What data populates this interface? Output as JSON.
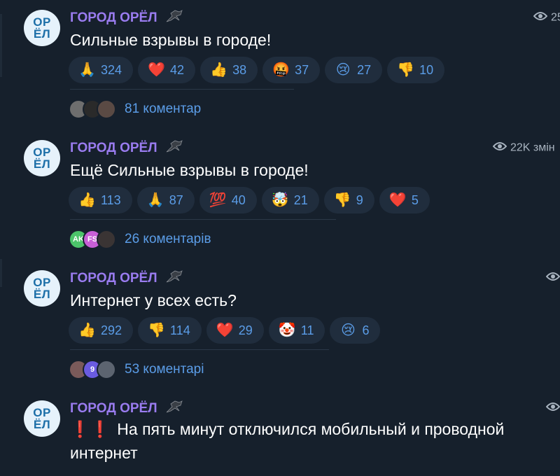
{
  "colors": {
    "background": "#16202c",
    "author": "#9a7cf0",
    "link": "#5b9de8",
    "reaction_bg": "#202d3d",
    "avatar_bg": "#e6f2fb",
    "avatar_fg": "#1d6fa8"
  },
  "posts": [
    {
      "avatar_text": "ОР\nЁЛ",
      "author": "ГОРОД ОРЁЛ",
      "views": "25",
      "text": "Сильные взрывы в городе!",
      "reactions": [
        {
          "icon": "praying-hands-icon",
          "emoji": "🙏",
          "count": "324"
        },
        {
          "icon": "red-heart-icon",
          "emoji": "❤️",
          "count": "42"
        },
        {
          "icon": "thumbs-up-icon",
          "emoji": "👍",
          "count": "38"
        },
        {
          "icon": "cursing-face-icon",
          "emoji": "🤬",
          "count": "37"
        },
        {
          "icon": "crying-face-icon",
          "emoji": "😢",
          "count": "27"
        },
        {
          "icon": "thumbs-down-icon",
          "emoji": "👎",
          "count": "10"
        }
      ],
      "comments": "81 коментар"
    },
    {
      "avatar_text": "ОР\nЁЛ",
      "author": "ГОРОД ОРЁЛ",
      "views": "22K змін",
      "text": "Ещё Сильные взрывы в городе!",
      "reactions": [
        {
          "icon": "thumbs-up-icon",
          "emoji": "👍",
          "count": "113"
        },
        {
          "icon": "praying-hands-icon",
          "emoji": "🙏",
          "count": "87"
        },
        {
          "icon": "hundred-points-icon",
          "emoji": "💯",
          "count": "40"
        },
        {
          "icon": "exploding-head-icon",
          "emoji": "🤯",
          "count": "21"
        },
        {
          "icon": "thumbs-down-icon",
          "emoji": "👎",
          "count": "9"
        },
        {
          "icon": "red-heart-icon",
          "emoji": "❤️",
          "count": "5"
        }
      ],
      "comment_avatars": [
        {
          "text": "AK",
          "color": "#4cc46a"
        },
        {
          "text": "FS",
          "color": "#c85fd6"
        }
      ],
      "comments": "26 коментарів"
    },
    {
      "avatar_text": "ОР\nЁЛ",
      "author": "ГОРОД ОРЁЛ",
      "views": "",
      "text": "Интернет у всех есть?",
      "reactions": [
        {
          "icon": "thumbs-up-icon",
          "emoji": "👍",
          "count": "292"
        },
        {
          "icon": "thumbs-down-icon",
          "emoji": "👎",
          "count": "114"
        },
        {
          "icon": "red-heart-icon",
          "emoji": "❤️",
          "count": "29"
        },
        {
          "icon": "clown-face-icon",
          "emoji": "🤡",
          "count": "11"
        },
        {
          "icon": "crying-face-icon",
          "emoji": "😢",
          "count": "6"
        }
      ],
      "comment_avatars": [
        {
          "text": "",
          "color": "#7a5a5a"
        },
        {
          "text": "9",
          "color": "#6a5be0"
        },
        {
          "text": "",
          "color": "#5c6470"
        }
      ],
      "comments": "53 коментарі"
    },
    {
      "avatar_text": "ОР\nЁЛ",
      "author": "ГОРОД ОРЁЛ",
      "views": "",
      "text_marks": "❗❗",
      "text": "На пять минут отключился мобильный и проводной интернет"
    }
  ]
}
